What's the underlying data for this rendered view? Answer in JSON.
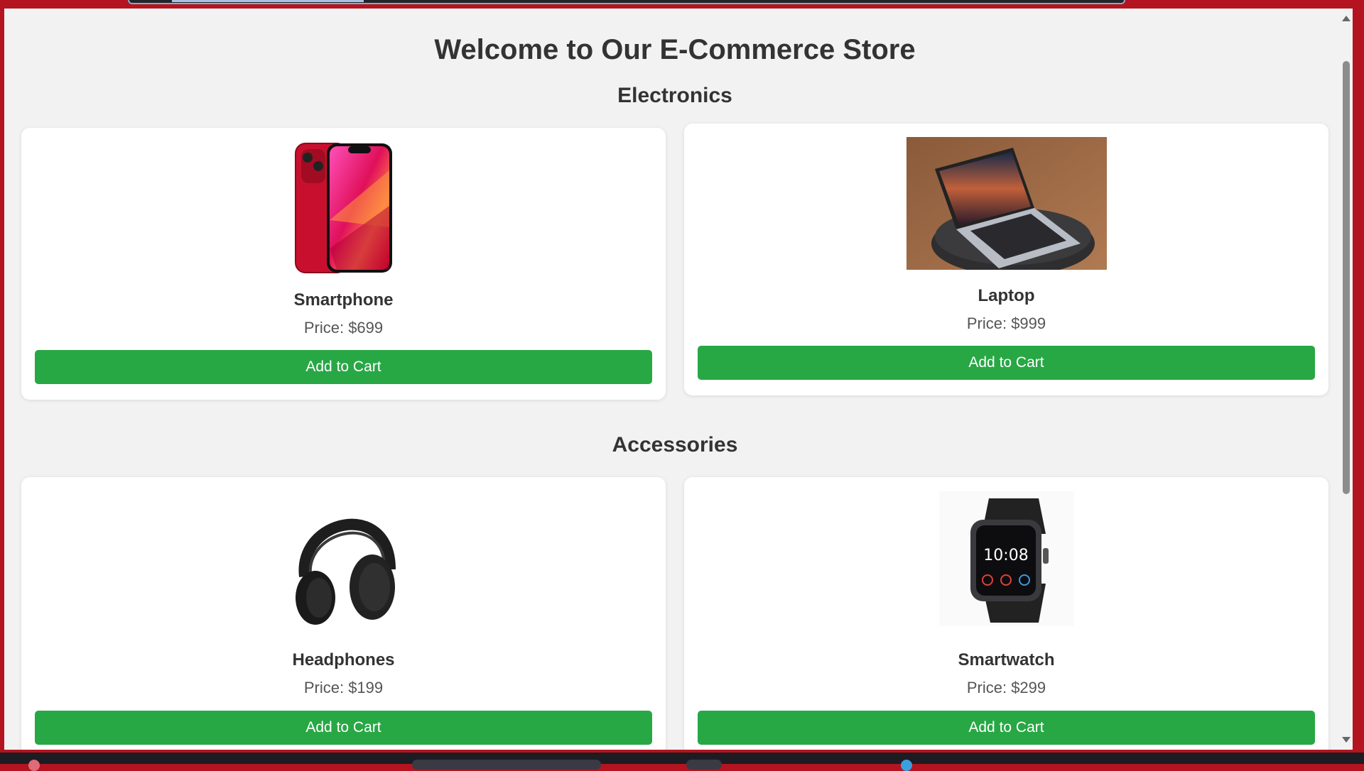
{
  "page": {
    "title": "Welcome to Our E-Commerce Store"
  },
  "sections": [
    {
      "title": "Electronics",
      "products": [
        {
          "name": "Smartphone",
          "price": "Price: $699",
          "button": "Add to Cart",
          "image_icon": "smartphone-icon"
        },
        {
          "name": "Laptop",
          "price": "Price: $999",
          "button": "Add to Cart",
          "image_icon": "laptop-icon"
        }
      ]
    },
    {
      "title": "Accessories",
      "products": [
        {
          "name": "Headphones",
          "price": "Price: $199",
          "button": "Add to Cart",
          "image_icon": "headphones-icon"
        },
        {
          "name": "Smartwatch",
          "price": "Price: $299",
          "button": "Add to Cart",
          "image_icon": "smartwatch-icon"
        }
      ]
    }
  ],
  "colors": {
    "background": "#f2f2f2",
    "card": "#ffffff",
    "button": "#28a745",
    "frame": "#b3141f"
  },
  "watch_display": "10:08"
}
